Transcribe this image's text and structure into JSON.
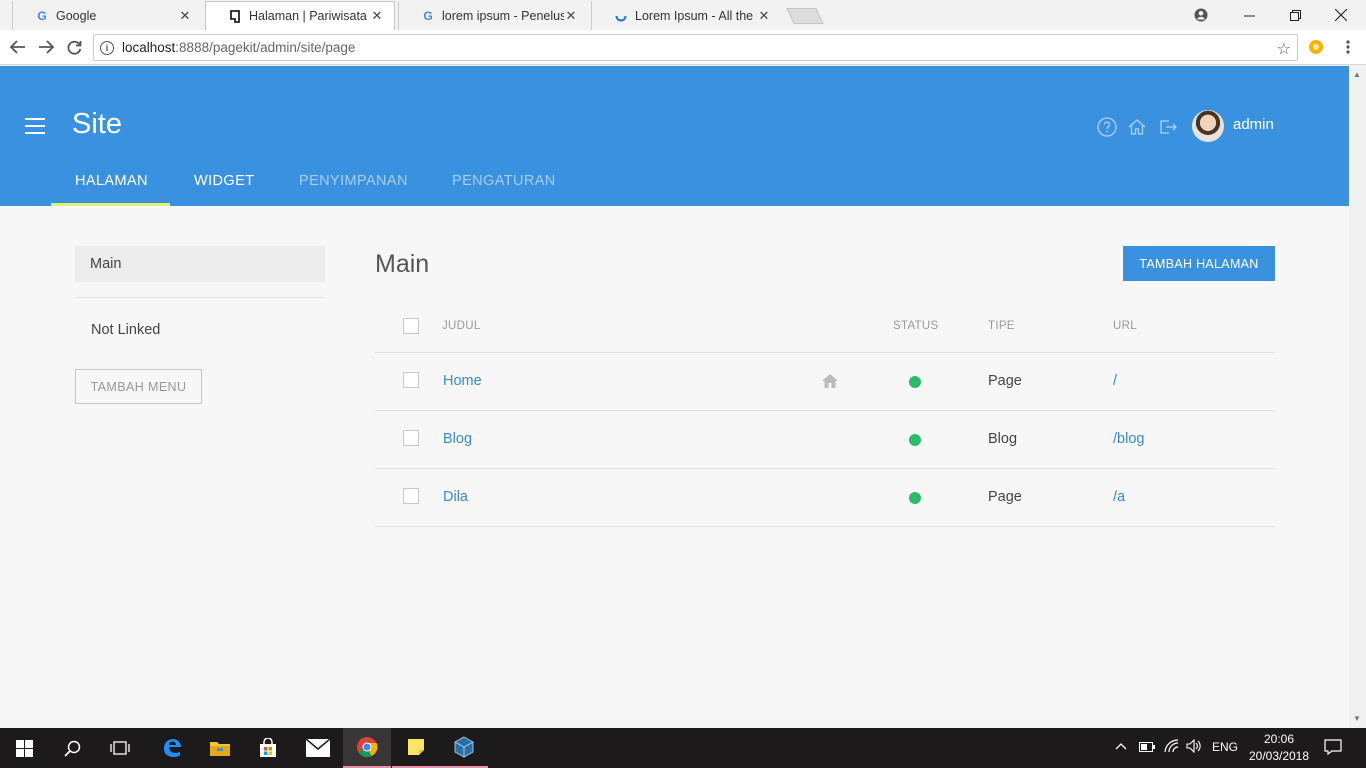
{
  "browser": {
    "tabs": [
      {
        "title": "Google",
        "favicon": "google-g-icon"
      },
      {
        "title": "Halaman | Pariwisata",
        "favicon": "pagekit-icon"
      },
      {
        "title": "lorem ipsum - Penelusuran",
        "favicon": "google-g-icon"
      },
      {
        "title": "Lorem Ipsum - All the fac",
        "favicon": "loading-spinner-icon"
      }
    ],
    "url_host": "localhost",
    "url_path": ":8888/pagekit/admin/site/page"
  },
  "header": {
    "title": "Site",
    "username": "admin",
    "nav_tabs": [
      "HALAMAN",
      "WIDGET",
      "PENYIMPANAN",
      "PENGATURAN"
    ],
    "icons": [
      "help-icon",
      "home-icon",
      "logout-icon"
    ]
  },
  "sidebar": {
    "menu_main": "Main",
    "not_linked": "Not Linked",
    "add_menu_label": "TAMBAH MENU"
  },
  "main": {
    "heading": "Main",
    "add_page_label": "TAMBAH HALAMAN",
    "columns": {
      "title": "JUDUL",
      "status": "STATUS",
      "type": "TIPE",
      "url": "URL"
    },
    "rows": [
      {
        "title": "Home",
        "is_home": true,
        "status": "enabled",
        "type": "Page",
        "url": "/"
      },
      {
        "title": "Blog",
        "is_home": false,
        "status": "enabled",
        "type": "Blog",
        "url": "/blog"
      },
      {
        "title": "Dila",
        "is_home": false,
        "status": "enabled",
        "type": "Page",
        "url": "/a"
      }
    ]
  },
  "taskbar": {
    "language": "ENG",
    "time": "20:06",
    "date": "20/03/2018",
    "apps": [
      "edge-icon",
      "file-explorer-icon",
      "store-icon",
      "mail-icon",
      "chrome-icon",
      "sticky-notes-icon",
      "virtualbox-icon"
    ]
  },
  "colors": {
    "accent": "#3a91e0",
    "status_enabled": "#2dbb6b",
    "nav_underline": "#dcf36b"
  }
}
